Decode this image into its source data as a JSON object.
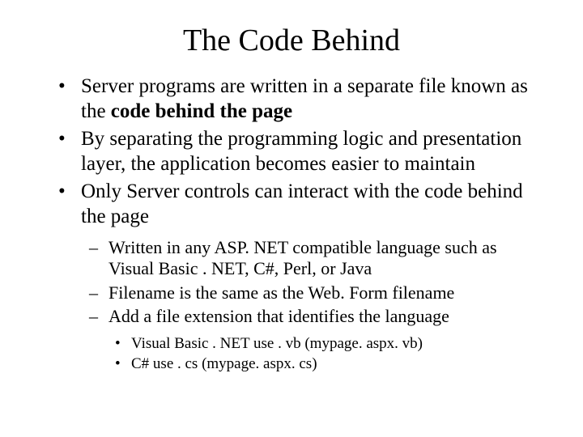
{
  "title": "The Code Behind",
  "bullets": {
    "b1_pre": "Server programs are written in a separate file known as the ",
    "b1_bold": "code behind the page",
    "b2": "By separating the programming logic and presentation layer, the application becomes easier to maintain",
    "b3": "Only Server controls can interact with the code behind the page"
  },
  "sub": {
    "s1": "Written in any ASP. NET compatible language such as Visual Basic . NET, C#, Perl, or Java",
    "s2": "Filename is the same as the Web. Form filename",
    "s3": "Add a file extension that identifies the language"
  },
  "subsub": {
    "ss1": "Visual Basic . NET use . vb (mypage. aspx. vb)",
    "ss2": "C# use . cs (mypage. aspx. cs)"
  }
}
